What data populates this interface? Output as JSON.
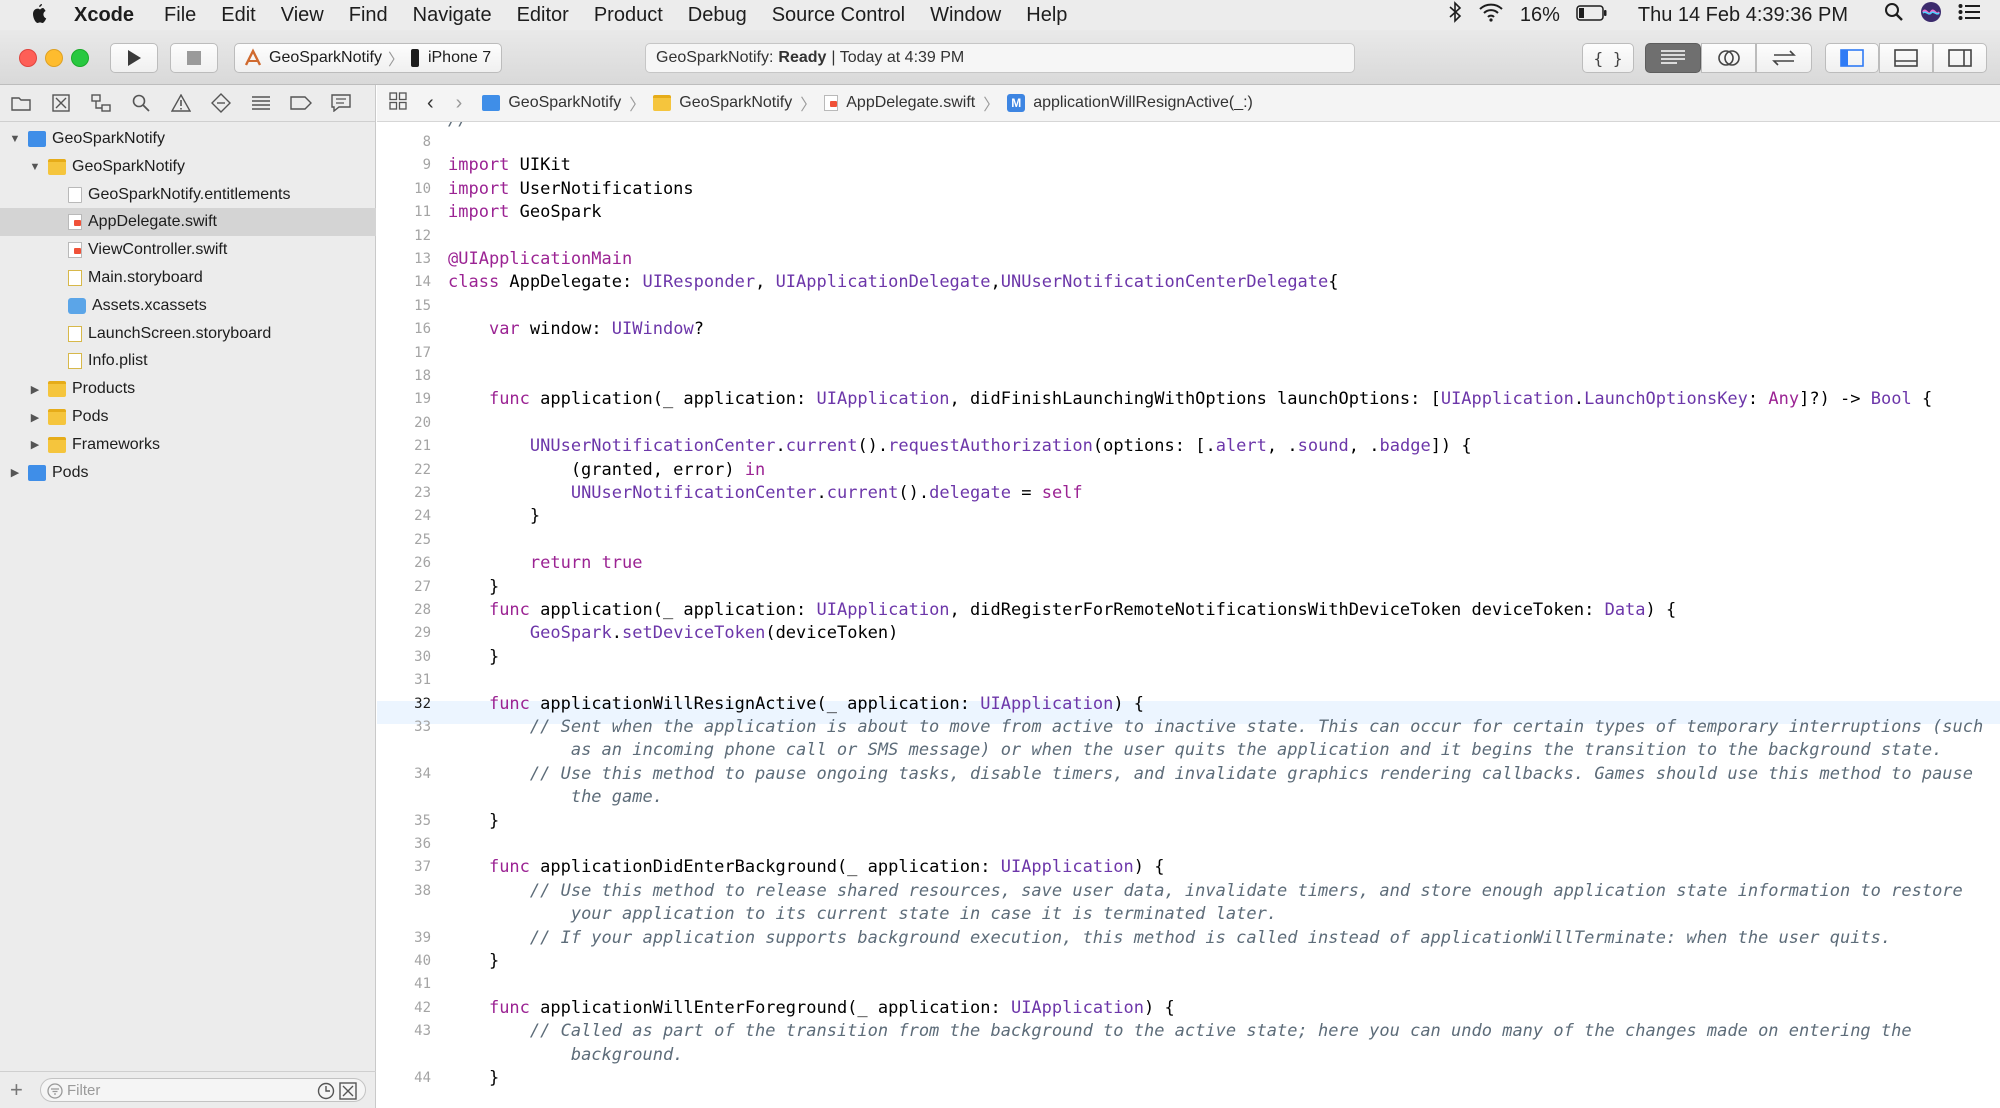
{
  "menubar": {
    "app": "Xcode",
    "items": [
      "File",
      "Edit",
      "View",
      "Find",
      "Navigate",
      "Editor",
      "Product",
      "Debug",
      "Source Control",
      "Window",
      "Help"
    ],
    "battery": "16%",
    "clock": "Thu 14 Feb  4:39:36 PM"
  },
  "toolbar": {
    "scheme": "GeoSparkNotify",
    "device": "iPhone 7",
    "status_project": "GeoSparkNotify:",
    "status_state": "Ready",
    "status_time": "| Today at 4:39 PM"
  },
  "navigator": {
    "tree": [
      {
        "label": "GeoSparkNotify",
        "indent": 0,
        "disc": "▼",
        "icon": "proj"
      },
      {
        "label": "GeoSparkNotify",
        "indent": 1,
        "disc": "▼",
        "icon": "folder"
      },
      {
        "label": "GeoSparkNotify.entitlements",
        "indent": 2,
        "disc": "",
        "icon": "doc"
      },
      {
        "label": "AppDelegate.swift",
        "indent": 2,
        "disc": "",
        "icon": "swift",
        "selected": true
      },
      {
        "label": "ViewController.swift",
        "indent": 2,
        "disc": "",
        "icon": "swift"
      },
      {
        "label": "Main.storyboard",
        "indent": 2,
        "disc": "",
        "icon": "storyb"
      },
      {
        "label": "Assets.xcassets",
        "indent": 2,
        "disc": "",
        "icon": "assets"
      },
      {
        "label": "LaunchScreen.storyboard",
        "indent": 2,
        "disc": "",
        "icon": "storyb"
      },
      {
        "label": "Info.plist",
        "indent": 2,
        "disc": "",
        "icon": "storyb"
      },
      {
        "label": "Products",
        "indent": 1,
        "disc": "▶",
        "icon": "folder"
      },
      {
        "label": "Pods",
        "indent": 1,
        "disc": "▶",
        "icon": "folder"
      },
      {
        "label": "Frameworks",
        "indent": 1,
        "disc": "▶",
        "icon": "folder"
      },
      {
        "label": "Pods",
        "indent": 0,
        "disc": "▶",
        "icon": "proj"
      }
    ],
    "filter_placeholder": "Filter"
  },
  "jumpbar": [
    "GeoSparkNotify",
    "GeoSparkNotify",
    "AppDelegate.swift",
    "applicationWillResignActive(_:)"
  ],
  "editor": {
    "current_line": "32",
    "lines": [
      {
        "n": "8",
        "t": []
      },
      {
        "n": "9",
        "t": [
          [
            "kw",
            "import"
          ],
          [
            "",
            "UIKit"
          ]
        ]
      },
      {
        "n": "10",
        "t": [
          [
            "kw",
            "import"
          ],
          [
            "",
            " UserNotifications"
          ]
        ]
      },
      {
        "n": "11",
        "t": [
          [
            "kw",
            "import"
          ],
          [
            "",
            " GeoSpark"
          ]
        ]
      },
      {
        "n": "12",
        "t": []
      },
      {
        "n": "13",
        "t": [
          [
            "at",
            "@UIApplicationMain"
          ]
        ]
      },
      {
        "n": "14",
        "t": [
          [
            "kw",
            "class"
          ],
          [
            "",
            " AppDelegate: "
          ],
          [
            "ty",
            "UIResponder"
          ],
          [
            "",
            ", "
          ],
          [
            "ty",
            "UIApplicationDelegate"
          ],
          [
            "",
            ","
          ],
          [
            "ty",
            "UNUserNotificationCenterDelegate"
          ],
          [
            "",
            "{"
          ]
        ]
      },
      {
        "n": "15",
        "t": []
      },
      {
        "n": "16",
        "t": [
          [
            "",
            "    "
          ],
          [
            "kw",
            "var"
          ],
          [
            "",
            " window: "
          ],
          [
            "ty",
            "UIWindow"
          ],
          [
            "",
            "?"
          ]
        ]
      },
      {
        "n": "17",
        "t": []
      },
      {
        "n": "18",
        "t": []
      },
      {
        "n": "19",
        "t": [
          [
            "",
            "    "
          ],
          [
            "kw",
            "func"
          ],
          [
            "",
            " application(_ application: "
          ],
          [
            "ty",
            "UIApplication"
          ],
          [
            "",
            ", didFinishLaunchingWithOptions launchOptions: ["
          ],
          [
            "ty",
            "UIApplication"
          ],
          [
            "",
            "."
          ],
          [
            "ty",
            "LaunchOptionsKey"
          ],
          [
            "",
            ": "
          ],
          [
            "kw",
            "Any"
          ],
          [
            "",
            "]?) -> "
          ],
          [
            "ty",
            "Bool"
          ],
          [
            "",
            " {"
          ]
        ]
      },
      {
        "n": "20",
        "t": []
      },
      {
        "n": "21",
        "t": [
          [
            "",
            "        "
          ],
          [
            "ty",
            "UNUserNotificationCenter"
          ],
          [
            "",
            "."
          ],
          [
            "fn",
            "current"
          ],
          [
            "",
            "()."
          ],
          [
            "fn",
            "requestAuthorization"
          ],
          [
            "",
            "(options: [."
          ],
          [
            "fn",
            "alert"
          ],
          [
            "",
            ", ."
          ],
          [
            "fn",
            "sound"
          ],
          [
            "",
            ", ."
          ],
          [
            "fn",
            "badge"
          ],
          [
            "",
            "]) {"
          ]
        ]
      },
      {
        "n": "22",
        "t": [
          [
            "",
            "            (granted, error) "
          ],
          [
            "kw",
            "in"
          ]
        ]
      },
      {
        "n": "23",
        "t": [
          [
            "",
            "            "
          ],
          [
            "ty",
            "UNUserNotificationCenter"
          ],
          [
            "",
            "."
          ],
          [
            "fn",
            "current"
          ],
          [
            "",
            "()."
          ],
          [
            "fn",
            "delegate"
          ],
          [
            "",
            " = "
          ],
          [
            "kw",
            "self"
          ]
        ]
      },
      {
        "n": "24",
        "t": [
          [
            "",
            "        }"
          ]
        ]
      },
      {
        "n": "25",
        "t": []
      },
      {
        "n": "26",
        "t": [
          [
            "",
            "        "
          ],
          [
            "kw",
            "return"
          ],
          [
            "",
            " "
          ],
          [
            "kw",
            "true"
          ]
        ]
      },
      {
        "n": "27",
        "t": [
          [
            "",
            "    }"
          ]
        ]
      },
      {
        "n": "28",
        "t": [
          [
            "",
            "    "
          ],
          [
            "kw",
            "func"
          ],
          [
            "",
            " application(_ application: "
          ],
          [
            "ty",
            "UIApplication"
          ],
          [
            "",
            ", didRegisterForRemoteNotificationsWithDeviceToken deviceToken: "
          ],
          [
            "ty",
            "Data"
          ],
          [
            "",
            ") {"
          ]
        ]
      },
      {
        "n": "29",
        "t": [
          [
            "",
            "        "
          ],
          [
            "ty",
            "GeoSpark"
          ],
          [
            "",
            "."
          ],
          [
            "fn",
            "setDeviceToken"
          ],
          [
            "",
            "(deviceToken)"
          ]
        ]
      },
      {
        "n": "30",
        "t": [
          [
            "",
            "    }"
          ]
        ]
      },
      {
        "n": "31",
        "t": []
      },
      {
        "n": "32",
        "t": [
          [
            "",
            "    "
          ],
          [
            "kw",
            "func"
          ],
          [
            "",
            " applicationWillResignActive(_ application: "
          ],
          [
            "ty",
            "UIApplication"
          ],
          [
            "",
            ") {"
          ]
        ]
      },
      {
        "n": "33",
        "t": [
          [
            "",
            "        "
          ],
          [
            "cm",
            "// Sent when the application is about to move from active to inactive state. This can occur for certain types of temporary interruptions (such"
          ]
        ]
      },
      {
        "n": "",
        "t": [
          [
            "",
            "            "
          ],
          [
            "cm",
            "as an incoming phone call or SMS message) or when the user quits the application and it begins the transition to the background state."
          ]
        ]
      },
      {
        "n": "34",
        "t": [
          [
            "",
            "        "
          ],
          [
            "cm",
            "// Use this method to pause ongoing tasks, disable timers, and invalidate graphics rendering callbacks. Games should use this method to pause"
          ]
        ]
      },
      {
        "n": "",
        "t": [
          [
            "",
            "            "
          ],
          [
            "cm",
            "the game."
          ]
        ]
      },
      {
        "n": "35",
        "t": [
          [
            "",
            "    }"
          ]
        ]
      },
      {
        "n": "36",
        "t": []
      },
      {
        "n": "37",
        "t": [
          [
            "",
            "    "
          ],
          [
            "kw",
            "func"
          ],
          [
            "",
            " applicationDidEnterBackground(_ application: "
          ],
          [
            "ty",
            "UIApplication"
          ],
          [
            "",
            ") {"
          ]
        ]
      },
      {
        "n": "38",
        "t": [
          [
            "",
            "        "
          ],
          [
            "cm",
            "// Use this method to release shared resources, save user data, invalidate timers, and store enough application state information to restore"
          ]
        ]
      },
      {
        "n": "",
        "t": [
          [
            "",
            "            "
          ],
          [
            "cm",
            "your application to its current state in case it is terminated later."
          ]
        ]
      },
      {
        "n": "39",
        "t": [
          [
            "",
            "        "
          ],
          [
            "cm",
            "// If your application supports background execution, this method is called instead of applicationWillTerminate: when the user quits."
          ]
        ]
      },
      {
        "n": "40",
        "t": [
          [
            "",
            "    }"
          ]
        ]
      },
      {
        "n": "41",
        "t": []
      },
      {
        "n": "42",
        "t": [
          [
            "",
            "    "
          ],
          [
            "kw",
            "func"
          ],
          [
            "",
            " applicationWillEnterForeground(_ application: "
          ],
          [
            "ty",
            "UIApplication"
          ],
          [
            "",
            ") {"
          ]
        ]
      },
      {
        "n": "43",
        "t": [
          [
            "",
            "        "
          ],
          [
            "cm",
            "// Called as part of the transition from the background to the active state; here you can undo many of the changes made on entering the"
          ]
        ]
      },
      {
        "n": "",
        "t": [
          [
            "",
            "            "
          ],
          [
            "cm",
            "background."
          ]
        ]
      },
      {
        "n": "44",
        "t": [
          [
            "",
            "    }"
          ]
        ]
      }
    ]
  }
}
